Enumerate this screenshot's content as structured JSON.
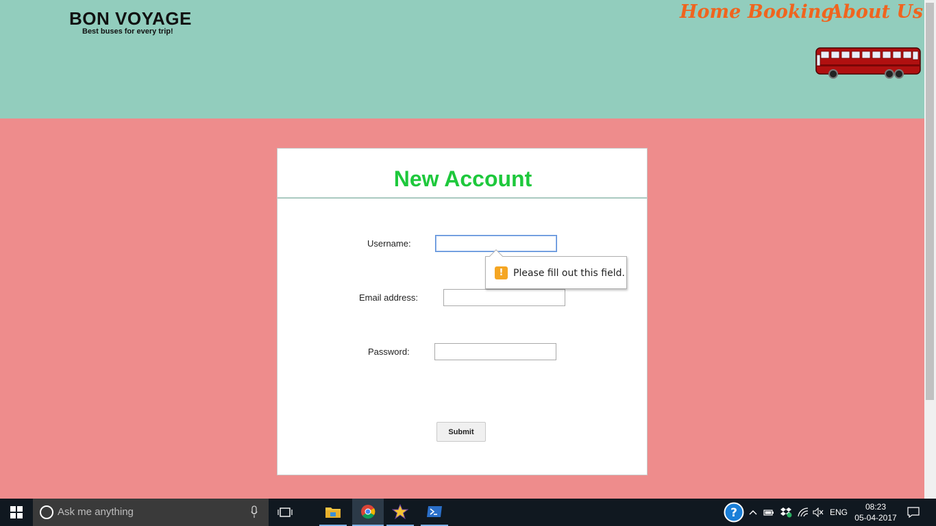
{
  "header": {
    "brand_title": "BON VOYAGE",
    "brand_tagline": "Best buses for every trip!",
    "nav": {
      "home": "Home",
      "booking": "Booking",
      "about": "About Us"
    }
  },
  "form": {
    "title": "New Account",
    "username_label": "Username:",
    "username_value": "",
    "email_label": "Email address:",
    "email_value": "",
    "password_label": "Password:",
    "password_value": "",
    "submit_label": "Submit",
    "validation_message": "Please fill out this field."
  },
  "taskbar": {
    "search_placeholder": "Ask me anything",
    "language": "ENG",
    "time": "08:23",
    "date": "05-04-2017",
    "pinned_apps": [
      "file-explorer-icon",
      "chrome-icon",
      "star-app-icon",
      "powershell-icon"
    ]
  },
  "colors": {
    "header_bg": "#92cdbd",
    "body_bg": "#ee8c8c",
    "nav_text": "#f0641e",
    "form_title": "#1ec83c"
  }
}
